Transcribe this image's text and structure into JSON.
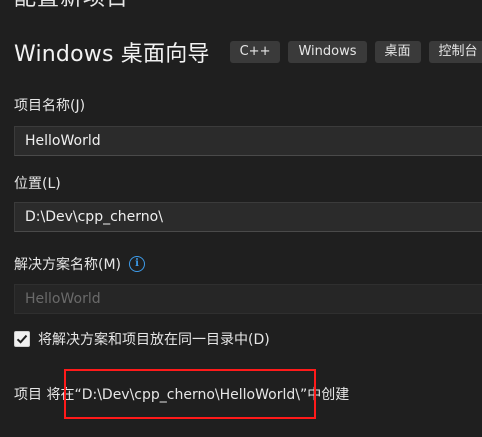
{
  "top_partial_title": "配置新项目",
  "header": {
    "title": "Windows 桌面向导",
    "tags": [
      "C++",
      "Windows",
      "桌面",
      "控制台"
    ]
  },
  "project_name": {
    "label": "项目名称(J)",
    "value": "HelloWorld"
  },
  "location": {
    "label": "位置(L)",
    "value": "D:\\Dev\\cpp_cherno\\"
  },
  "solution_name": {
    "label": "解决方案名称(M)",
    "info_icon": "info-icon",
    "value": "HelloWorld"
  },
  "checkbox": {
    "label": "将解决方案和项目放在同一目录中(D)",
    "checked": true
  },
  "summary": {
    "text": "项目 将在“D:\\Dev\\cpp_cherno\\HelloWorld\\”中创建"
  },
  "colors": {
    "background": "#1f1f1f",
    "input_bg": "#2b2b2b",
    "tag_bg": "#3a3a3a",
    "info_blue": "#3d9be9",
    "highlight_red": "#ff1a1a"
  }
}
